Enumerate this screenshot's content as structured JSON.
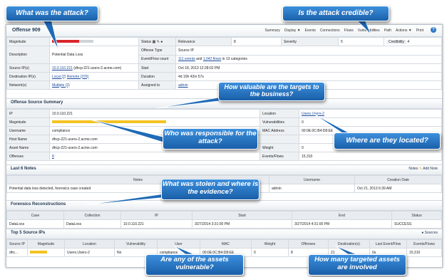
{
  "callouts": {
    "what_attack": "What was the attack?",
    "credible": "Is the attack credible?",
    "valuable": "How valuable are the targets to the business?",
    "responsible": "Who was responsible for the attack?",
    "located": "Where are they located?",
    "stolen": "What was stolen and where is the evidence?",
    "vulnerable": "Are any of the assets vulnerable?",
    "targeted": "How many targeted assets are involved"
  },
  "offense": {
    "title": "Offense 909",
    "toolbar": [
      "Summary",
      "Display ▼",
      "Events",
      "Connections",
      "Flows",
      "Vulnerabilities",
      "Path",
      "Actions ▼",
      "Print"
    ],
    "rows": {
      "magnitude_label": "Magnitude",
      "status_label": "Status",
      "relevance_label": "Relevance",
      "relevance_value": "8",
      "severity_label": "Severity",
      "severity_value": "5",
      "credibility_label": "Credibility",
      "credibility_value": "4",
      "description_label": "Description",
      "description_value": "Potential Data Loss",
      "offense_type_label": "Offense Type",
      "offense_type_value": "Source IP",
      "event_flow_label": "Event/Flow count",
      "events_link": "111 events",
      "flows_link": "1,042 flows",
      "categories_text": "in 13 categories",
      "source_ip_label": "Source IP(s)",
      "source_ip_link": "10.0.110.221",
      "source_ip_host": "(dhcp-221-users-2.acme.com)",
      "start_label": "Start",
      "start_value": "Oct 18, 2013 12:28:02 PM",
      "dest_ip_label": "Destination IP(s)",
      "dest_local": "Local (2)",
      "dest_remote": "Remote (376)",
      "duration_label": "Duration",
      "duration_value": "4d 10h 42m 57s",
      "networks_label": "Network(s)",
      "networks_link": "Multiple (3)",
      "assigned_label": "Assigned to",
      "assigned_value": "admin"
    }
  },
  "source_summary": {
    "title": "Offense Source Summary",
    "ip_label": "IP",
    "ip_value": "10.0.110.221",
    "magnitude_label": "Magnitude",
    "username_label": "Username",
    "username_value": "compliance",
    "host_label": "Host Name",
    "host_value": "dhcp-221-users-2.acme.com",
    "asset_label": "Asset Name",
    "asset_value": "dhcp-221-users-2.acme.com",
    "offenses_label": "Offenses",
    "offenses_value": "8",
    "location_label": "Location",
    "location_value": "Users.Users-2",
    "vuln_label": "Vulnerabilities",
    "vuln_value": "0",
    "mac_label": "MAC Address",
    "mac_value": "00:0E:0C:B4:D8:EE",
    "weight_label": "Weight",
    "weight_value": "0",
    "events_label": "Events/Flows",
    "events_value": "15,310"
  },
  "notes": {
    "title": "Last 6 Notes",
    "notes_btn": "Notes",
    "add_btn": "Add Note",
    "headers": [
      "Notes",
      "Username",
      "Creation Date"
    ],
    "row": [
      "Potential data loss detected, forensics case created",
      "admin",
      "Oct 21, 2013 6:39 AM"
    ]
  },
  "forensics": {
    "title": "Forensics Reconstructions",
    "headers": [
      "Case",
      "Collection",
      "IP",
      "Start",
      "End",
      "Status"
    ],
    "row": [
      "DataLoss",
      "DataLoss",
      "10.0.110.221",
      "3/27/2014 3:31:00 PM",
      "3/27/2014 4:31:00 PM",
      "SUCCESS"
    ]
  },
  "top_ips": {
    "title": "Top 5 Source IPs",
    "sources_btn": "Sources",
    "headers": [
      "Source IP",
      "Magnitude",
      "Location",
      "Vulnerability",
      "User",
      "MAC",
      "Weight",
      "Offenses",
      "Destination(s)",
      "Last Event/Flow",
      "Events/Flows"
    ],
    "row": [
      "dhc...",
      "",
      "Users.Users-2",
      "No",
      "compliance",
      "00:0E:0C:B4:D8:EE",
      "0",
      "8",
      "21",
      "0s",
      "15,310"
    ],
    "magnitude_fraction": 0.6
  },
  "colors": {
    "callout_bg": "#2a78c8",
    "magnitude_red": "#d8262c",
    "magnitude_yellow": "#f4c322"
  }
}
